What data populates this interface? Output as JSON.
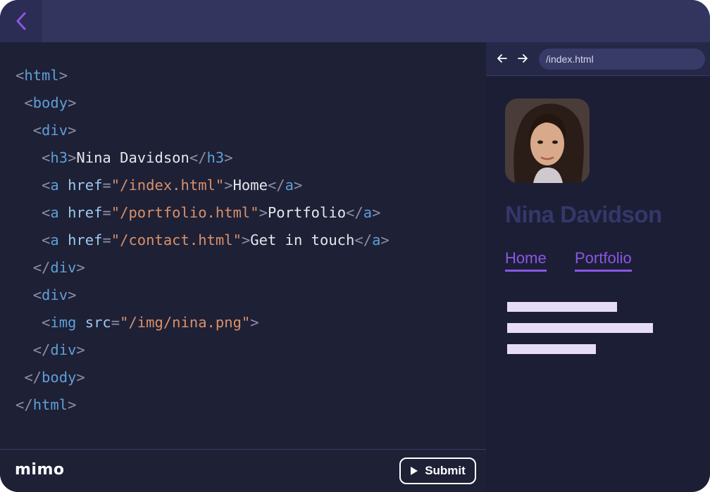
{
  "app": {
    "brand": "mimo"
  },
  "colors": {
    "accent": "#8a57e6",
    "tag": "#5e9fd6",
    "string": "#d9916a",
    "attribute": "#9ec8ef"
  },
  "icons": {
    "back": "chevron-left-icon",
    "browser_back": "arrow-left-icon",
    "browser_forward": "arrow-right-icon",
    "submit": "play-icon"
  },
  "editor": {
    "lines": [
      [
        {
          "c": "p",
          "v": "<"
        },
        {
          "c": "t",
          "v": "html"
        },
        {
          "c": "p",
          "v": ">"
        }
      ],
      [
        {
          "c": "x",
          "v": " "
        },
        {
          "c": "p",
          "v": "<"
        },
        {
          "c": "t",
          "v": "body"
        },
        {
          "c": "p",
          "v": ">"
        }
      ],
      [
        {
          "c": "x",
          "v": "  "
        },
        {
          "c": "p",
          "v": "<"
        },
        {
          "c": "t",
          "v": "div"
        },
        {
          "c": "p",
          "v": ">"
        }
      ],
      [
        {
          "c": "x",
          "v": "   "
        },
        {
          "c": "p",
          "v": "<"
        },
        {
          "c": "t",
          "v": "h3"
        },
        {
          "c": "p",
          "v": ">"
        },
        {
          "c": "x",
          "v": "Nina Davidson"
        },
        {
          "c": "p",
          "v": "</"
        },
        {
          "c": "t",
          "v": "h3"
        },
        {
          "c": "p",
          "v": ">"
        }
      ],
      [
        {
          "c": "x",
          "v": "   "
        },
        {
          "c": "p",
          "v": "<"
        },
        {
          "c": "t",
          "v": "a"
        },
        {
          "c": "x",
          "v": " "
        },
        {
          "c": "a",
          "v": "href"
        },
        {
          "c": "p",
          "v": "="
        },
        {
          "c": "s",
          "v": "\"/index.html\""
        },
        {
          "c": "p",
          "v": ">"
        },
        {
          "c": "x",
          "v": "Home"
        },
        {
          "c": "p",
          "v": "</"
        },
        {
          "c": "t",
          "v": "a"
        },
        {
          "c": "p",
          "v": ">"
        }
      ],
      [
        {
          "c": "x",
          "v": "   "
        },
        {
          "c": "p",
          "v": "<"
        },
        {
          "c": "t",
          "v": "a"
        },
        {
          "c": "x",
          "v": " "
        },
        {
          "c": "a",
          "v": "href"
        },
        {
          "c": "p",
          "v": "="
        },
        {
          "c": "s",
          "v": "\"/portfolio.html\""
        },
        {
          "c": "p",
          "v": ">"
        },
        {
          "c": "x",
          "v": "Portfolio"
        },
        {
          "c": "p",
          "v": "</"
        },
        {
          "c": "t",
          "v": "a"
        },
        {
          "c": "p",
          "v": ">"
        }
      ],
      [
        {
          "c": "x",
          "v": "   "
        },
        {
          "c": "p",
          "v": "<"
        },
        {
          "c": "t",
          "v": "a"
        },
        {
          "c": "x",
          "v": " "
        },
        {
          "c": "a",
          "v": "href"
        },
        {
          "c": "p",
          "v": "="
        },
        {
          "c": "s",
          "v": "\"/contact.html\""
        },
        {
          "c": "p",
          "v": ">"
        },
        {
          "c": "x",
          "v": "Get in touch"
        },
        {
          "c": "p",
          "v": "</"
        },
        {
          "c": "t",
          "v": "a"
        },
        {
          "c": "p",
          "v": ">"
        }
      ],
      [
        {
          "c": "x",
          "v": "  "
        },
        {
          "c": "p",
          "v": "</"
        },
        {
          "c": "t",
          "v": "div"
        },
        {
          "c": "p",
          "v": ">"
        }
      ],
      [
        {
          "c": "x",
          "v": "  "
        },
        {
          "c": "p",
          "v": "<"
        },
        {
          "c": "t",
          "v": "div"
        },
        {
          "c": "p",
          "v": ">"
        }
      ],
      [
        {
          "c": "x",
          "v": "   "
        },
        {
          "c": "p",
          "v": "<"
        },
        {
          "c": "t",
          "v": "img"
        },
        {
          "c": "x",
          "v": " "
        },
        {
          "c": "a",
          "v": "src"
        },
        {
          "c": "p",
          "v": "="
        },
        {
          "c": "s",
          "v": "\"/img/nina.png\""
        },
        {
          "c": "p",
          "v": ">"
        }
      ],
      [
        {
          "c": "x",
          "v": "  "
        },
        {
          "c": "p",
          "v": "</"
        },
        {
          "c": "t",
          "v": "div"
        },
        {
          "c": "p",
          "v": ">"
        }
      ],
      [
        {
          "c": "x",
          "v": " "
        },
        {
          "c": "p",
          "v": "</"
        },
        {
          "c": "t",
          "v": "body"
        },
        {
          "c": "p",
          "v": ">"
        }
      ],
      [
        {
          "c": "p",
          "v": "</"
        },
        {
          "c": "t",
          "v": "html"
        },
        {
          "c": "p",
          "v": ">"
        }
      ]
    ]
  },
  "footer": {
    "submit_label": "Submit"
  },
  "preview": {
    "url": "/index.html",
    "name": "Nina Davidson",
    "links": [
      "Home",
      "Portfolio"
    ]
  }
}
